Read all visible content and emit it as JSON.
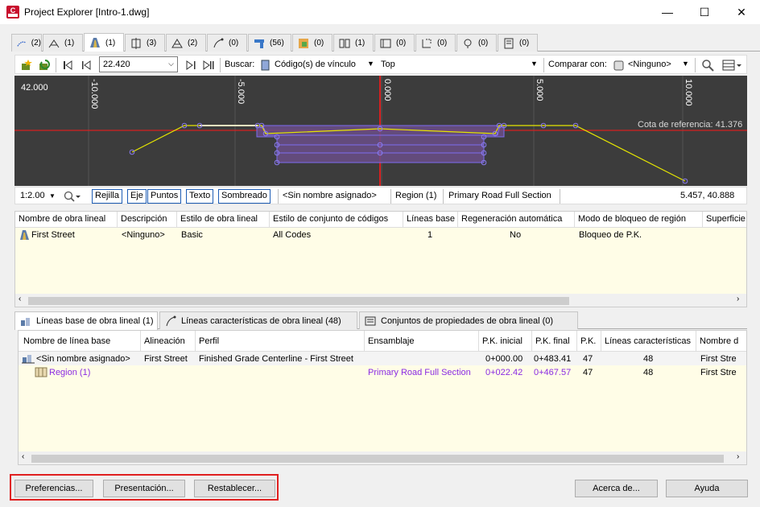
{
  "window": {
    "title": "Project Explorer [Intro-1.dwg]",
    "minimize": "—",
    "maximize": "☐",
    "close": "✕"
  },
  "object_tabs": [
    {
      "icon": "alignment-icon",
      "count": "(2)"
    },
    {
      "icon": "profile-icon",
      "count": "(1)"
    },
    {
      "icon": "corridor-icon",
      "count": "(1)",
      "active": true
    },
    {
      "icon": "assembly-icon",
      "count": "(3)"
    },
    {
      "icon": "surface-icon",
      "count": "(2)"
    },
    {
      "icon": "feature-line-icon",
      "count": "(0)"
    },
    {
      "icon": "pipe-network-icon",
      "count": "(56)"
    },
    {
      "icon": "point-group-icon",
      "count": "(0)"
    },
    {
      "icon": "sample-line-icon",
      "count": "(1)"
    },
    {
      "icon": "section-view-icon",
      "count": "(0)"
    },
    {
      "icon": "parcel-icon",
      "count": "(0)"
    },
    {
      "icon": "intersection-icon",
      "count": "(0)"
    },
    {
      "icon": "catalog-icon",
      "count": "(0)"
    }
  ],
  "toolbar": {
    "station_value": "22.420",
    "search_label": "Buscar:",
    "search_type": "Código(s) de vínculo",
    "search_value": "Top",
    "compare_label": "Comparar con:",
    "compare_value": "<Ninguno>"
  },
  "viewer": {
    "elevation_label": "42.000",
    "offset_ticks": [
      "-10.000",
      "-5.000",
      "0.000",
      "5.000",
      "10.000"
    ],
    "reference_label": "Cota de referencia: 41.376"
  },
  "viewer_status": {
    "scale": "1:2.00",
    "toggle_grid": "Rejilla",
    "toggle_axis": "Eje",
    "toggle_points": "Puntos",
    "toggle_text": "Texto",
    "toggle_shading": "Sombreado",
    "baseline_name": "<Sin nombre asignado>",
    "region_name": "Region (1)",
    "assembly_name": "Primary Road Full Section",
    "coordinates": "5.457, 40.888"
  },
  "corridor_table": {
    "columns": [
      "Nombre de obra lineal",
      "Descripción",
      "Estilo de obra lineal",
      "Estilo de conjunto de códigos",
      "Líneas base",
      "Regeneración automática",
      "Modo de bloqueo de región",
      "Superficie"
    ],
    "rows": [
      {
        "name": "First Street",
        "description": "<Ninguno>",
        "style": "Basic",
        "code_set": "All Codes",
        "baselines": "1",
        "auto_rebuild": "No",
        "lock_mode": "Bloqueo de P.K."
      }
    ]
  },
  "bottom_tabs": [
    {
      "label": "Líneas base de obra lineal (1)",
      "icon": "baseline-icon",
      "active": true
    },
    {
      "label": "Líneas características de obra lineal (48)",
      "icon": "feature-line-icon"
    },
    {
      "label": "Conjuntos de propiedades de obra lineal (0)",
      "icon": "property-set-icon"
    }
  ],
  "baseline_table": {
    "columns": [
      "Nombre de línea base",
      "Alineación",
      "Perfil",
      "Ensamblaje",
      "P.K. inicial",
      "P.K. final",
      "P.K.",
      "Líneas características",
      "Nombre d"
    ],
    "rows": [
      {
        "name": "<Sin nombre asignado>",
        "alignment": "First Street",
        "profile": "Finished Grade Centerline - First Street",
        "assembly": "",
        "start": "0+000.00",
        "end": "0+483.41",
        "stations": "47",
        "features": "48",
        "extra": "First Stre"
      },
      {
        "name": "Region (1)",
        "alignment": "",
        "profile": "",
        "assembly": "Primary Road Full Section",
        "start": "0+022.42",
        "end": "0+467.57",
        "stations": "47",
        "features": "48",
        "extra": "First Stre"
      }
    ]
  },
  "footer": {
    "preferences": "Preferencias...",
    "presentation": "Presentación...",
    "reset": "Restablecer...",
    "about": "Acerca de...",
    "help": "Ayuda"
  },
  "colors": {
    "accent_red": "#e02020",
    "region_purple": "#8a2be2",
    "viewer_bg": "#3c3c3c",
    "row_yellow": "#fffde7"
  }
}
